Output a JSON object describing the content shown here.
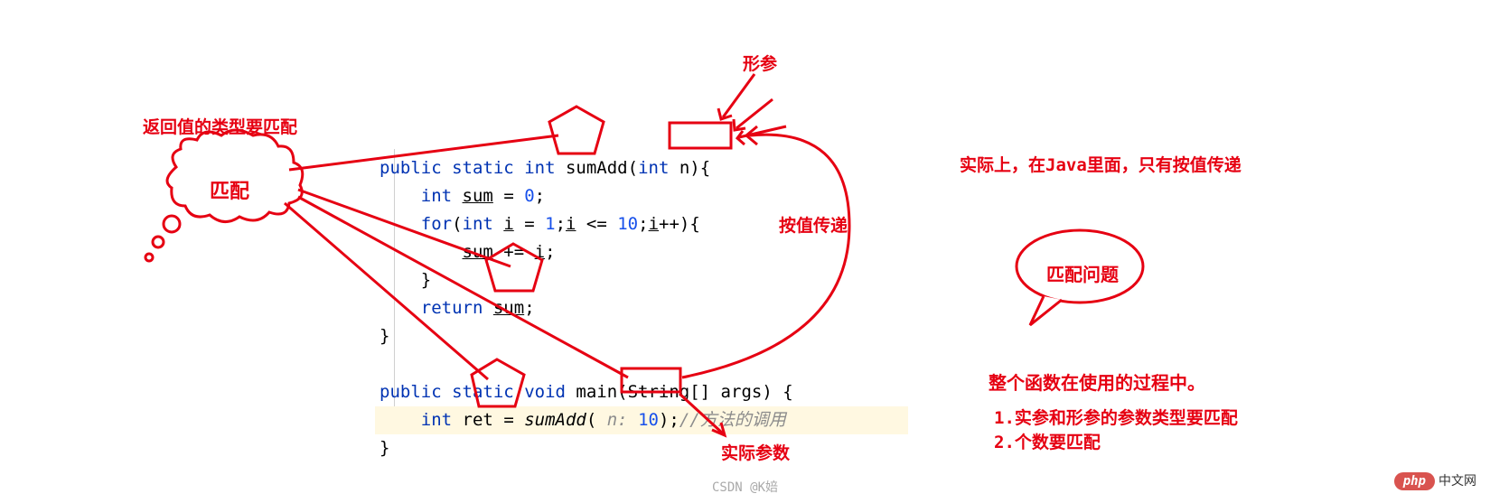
{
  "annotations": {
    "return_type_label": "返回值的类型要匹配",
    "match_bubble": "匹配",
    "formal_param": "形参",
    "pass_by_value": "按值传递",
    "actual_param": "实际参数",
    "java_note": "实际上，在Java里面，只有按值传递",
    "match_problem": "匹配问题",
    "process_note": "整个函数在使用的过程中。",
    "rule1": "1.实参和形参的参数类型要匹配",
    "rule2": "2.个数要匹配"
  },
  "code": {
    "l1_public": "public",
    "l1_static": "static",
    "l1_int": "int",
    "l1_func": "sumAdd",
    "l1_paren_open": "(",
    "l1_param_type": "int",
    "l1_param_name": "n",
    "l1_tail": "){",
    "l2_indent": "    ",
    "l2_type": "int",
    "l2_rest1": " ",
    "l2_sum": "sum",
    "l2_rest2": " = ",
    "l2_zero": "0",
    "l2_semi": ";",
    "l3_for": "for",
    "l3_open": "(",
    "l3_int": "int",
    "l3_rest1": " ",
    "l3_i": "i",
    "l3_rest2": " = ",
    "l3_one": "1",
    "l3_semi1": ";",
    "l3_cond_i": "i",
    "l3_cond_op": " <= ",
    "l3_ten": "10",
    "l3_semi2": ";",
    "l3_inc_i": "i",
    "l3_inc": "++){",
    "l4_indent": "        ",
    "l4_sum": "sum",
    "l4_op": " += ",
    "l4_i": "i",
    "l4_semi": ";",
    "l5_close": "    }",
    "l6_return": "return",
    "l6_sp": " ",
    "l6_sum": "sum",
    "l6_semi": ";",
    "l7_close": "}",
    "l9_public": "public",
    "l9_static": "static",
    "l9_void": "void",
    "l9_main": "main",
    "l9_args": "(String[] args) {",
    "l10_indent": "    ",
    "l10_int": "int",
    "l10_sp1": " ",
    "l10_ret": "ret",
    "l10_eq": " = ",
    "l10_call": "sumAdd",
    "l10_open": "( ",
    "l10_hint": "n: ",
    "l10_arg": "10",
    "l10_close": ");",
    "l10_comment": "//方法的调用",
    "l11_close": "}"
  },
  "watermark": "CSDN @K婄",
  "php_badge": {
    "pill": "php",
    "text": "中文网"
  }
}
